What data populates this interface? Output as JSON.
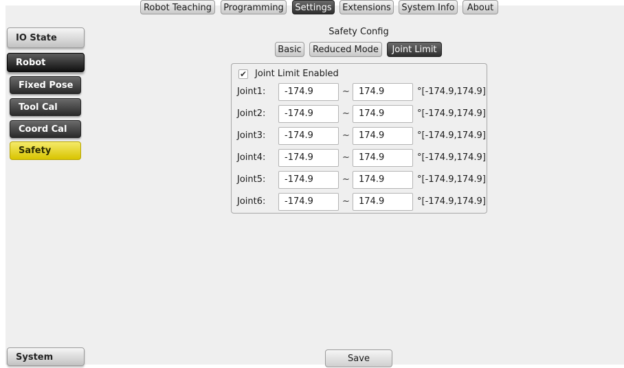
{
  "top_tabs": [
    {
      "label": "Robot Teaching"
    },
    {
      "label": "Programming"
    },
    {
      "label": "Settings"
    },
    {
      "label": "Extensions"
    },
    {
      "label": "System Info"
    },
    {
      "label": "About"
    }
  ],
  "active_top_tab": "Settings",
  "sidebar": {
    "io_state": "IO State",
    "robot": "Robot",
    "fixed_pose": "Fixed Pose",
    "tool_cal": "Tool Cal",
    "coord_cal": "Coord Cal",
    "safety": "Safety",
    "system": "System"
  },
  "section_title": "Safety Config",
  "sub_tabs": [
    {
      "label": "Basic"
    },
    {
      "label": "Reduced Mode"
    },
    {
      "label": "Joint Limit"
    }
  ],
  "active_sub_tab": "Joint Limit",
  "joint_limit": {
    "enabled_label": "Joint Limit Enabled",
    "enabled": true,
    "check_glyph": "✔",
    "separator": "~",
    "joints": [
      {
        "label": "Joint1:",
        "min": "-174.9",
        "max": "174.9",
        "range": "°[-174.9,174.9]"
      },
      {
        "label": "Joint2:",
        "min": "-174.9",
        "max": "174.9",
        "range": "°[-174.9,174.9]"
      },
      {
        "label": "Joint3:",
        "min": "-174.9",
        "max": "174.9",
        "range": "°[-174.9,174.9]"
      },
      {
        "label": "Joint4:",
        "min": "-174.9",
        "max": "174.9",
        "range": "°[-174.9,174.9]"
      },
      {
        "label": "Joint5:",
        "min": "-174.9",
        "max": "174.9",
        "range": "°[-174.9,174.9]"
      },
      {
        "label": "Joint6:",
        "min": "-174.9",
        "max": "174.9",
        "range": "°[-174.9,174.9]"
      }
    ]
  },
  "save_label": "Save",
  "colors": {
    "active_tab": "#3a3a3a",
    "selected_item": "#e6d42a",
    "background": "#efefef"
  }
}
